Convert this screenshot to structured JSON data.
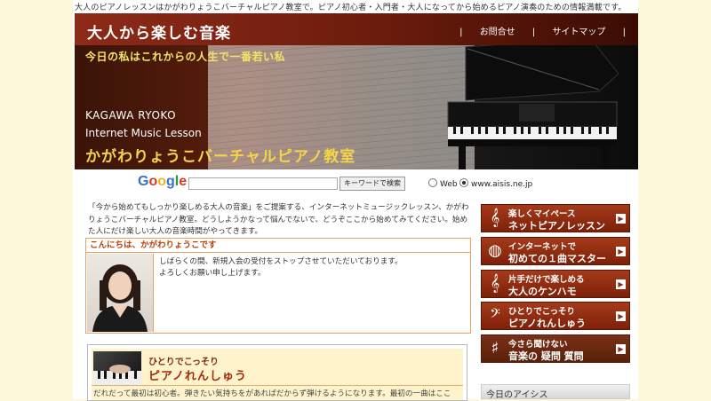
{
  "tagline": "大人のピアノレッスンはかがわりょうこバーチャルピアノ教室で。ピアノ初心者・入門者・大人になってから始めるピアノ演奏のための情報満載です。",
  "header": {
    "site_title": "大人から楽しむ音楽",
    "links": [
      "お問合せ",
      "サイトマップ"
    ],
    "separator": "|",
    "slogan": "今日の私はこれからの人生で一番若い私",
    "name_en": "KAGAWA RYOKO",
    "subtitle_en": "Internet Music Lesson",
    "title_jp": "かがわりょうこバーチャルピアノ教室"
  },
  "search": {
    "logo_letters": [
      "G",
      "o",
      "o",
      "g",
      "l",
      "e"
    ],
    "logo_colors": [
      "#3a6fd8",
      "#d83a2a",
      "#e8b81a",
      "#3a6fd8",
      "#2a9a3a",
      "#d83a2a"
    ],
    "input_value": "",
    "button_label": "キーワードで検索",
    "options": [
      "Web",
      "www.aisis.ne.jp"
    ],
    "selected": "www.aisis.ne.jp"
  },
  "intro_text": "「今から始めてもしっかり楽しめる大人の音楽」をご提案する、インターネットミュージックレッスン、かがわりょうこバーチャルピアノ教室。どうしようかなって悩んでないで、どうぞここから始めてみてください。始めた人にだけ楽しい大人の音楽時間がやってきます。",
  "greeting": {
    "title": "こんにちは、かがわりょうこです",
    "lines": [
      "しばらくの間、新規入会の受付をストップさせていただいております。",
      "よろしくお願い申し上げます。"
    ]
  },
  "feature": {
    "title_small": "ひとりでこっそり",
    "title_big": "ピアノれんしゅう",
    "text": "だれだって最初は初心者。弾きたい気持ちをがあればだからず弾けるようになります。最初の一曲はここ"
  },
  "menu": [
    {
      "icon": "treble-clef-icon",
      "glyph": "𝄞",
      "line1": "楽しくマイペース",
      "line2": "ネットピアノレッスン"
    },
    {
      "icon": "globe-icon",
      "glyph": "◍",
      "line1": "インターネットで",
      "line2": "初めての１曲マスター"
    },
    {
      "icon": "treble-clef-icon",
      "glyph": "𝄞",
      "line1": "片手だけで楽しめる",
      "line2": "大人のケンハモ"
    },
    {
      "icon": "bass-clef-icon",
      "glyph": "𝄢",
      "line1": "ひとりでこっそり",
      "line2": "ピアノれんしゅう"
    },
    {
      "icon": "sharp-icon",
      "glyph": "♯",
      "line1": "今さら聞けない",
      "line2": "音楽の 疑問 質問"
    }
  ],
  "menu_arrow": "▶",
  "aisis_title": "今日のアイシス",
  "colors": {
    "accent": "#8e2a18",
    "greeting_border": "#e8a060",
    "slogan": "#f2e26a"
  }
}
